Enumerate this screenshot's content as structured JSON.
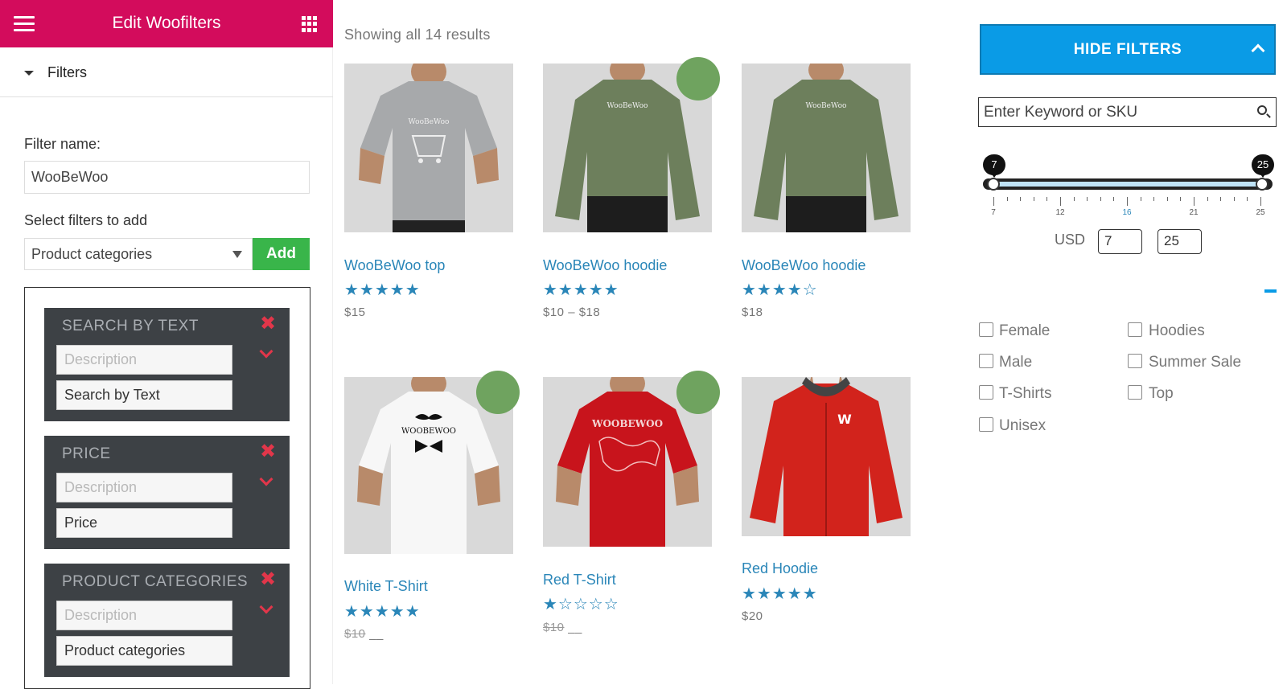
{
  "panel": {
    "title": "Edit Woofilters",
    "section": "Filters",
    "filter_name_label": "Filter name:",
    "filter_name_value": "WooBeWoo",
    "select_label": "Select filters to add",
    "select_value": "Product categories",
    "add_label": "Add",
    "close_glyph": "✖",
    "cards": [
      {
        "title": "SEARCH BY TEXT",
        "description_placeholder": "Description",
        "name": "Search by Text"
      },
      {
        "title": "PRICE",
        "description_placeholder": "Description",
        "name": "Price"
      },
      {
        "title": "PRODUCT CATEGORIES",
        "description_placeholder": "Description",
        "name": "Product categories"
      }
    ]
  },
  "shop": {
    "results": "Showing all 14 results",
    "products": [
      {
        "name": "WooBeWoo top",
        "rating": 5,
        "stars": "★★★★★",
        "price": "$15",
        "color": "#a3a5a8",
        "on_sale": false
      },
      {
        "name": "WooBeWoo hoodie",
        "rating": 5,
        "stars": "★★★★★",
        "price": "$10 – $18",
        "color": "#6d7f5c",
        "on_sale": true
      },
      {
        "name": "WooBeWoo hoodie",
        "rating": 4,
        "stars": "★★★★☆",
        "price": "$18",
        "color": "#6d7f5c",
        "on_sale": false
      },
      {
        "name": "White T-Shirt",
        "rating": 5,
        "stars": "★★★★★",
        "price_old": "$10",
        "price_new": "__",
        "color": "#f4f4f4",
        "on_sale": true
      },
      {
        "name": "Red T-Shirt",
        "rating": 1,
        "stars": "★☆☆☆☆",
        "price_old": "$10",
        "price_new": "__",
        "color": "#c8141c",
        "on_sale": true
      },
      {
        "name": "Red Hoodie",
        "rating": 5,
        "stars": "★★★★★",
        "price": "$20",
        "color": "#d2231c",
        "on_sale": false
      }
    ]
  },
  "filters": {
    "hide_label": "HIDE FILTERS",
    "search_placeholder": "Enter Keyword or SKU",
    "price_min": "7",
    "price_max": "25",
    "tick_labels": [
      "7",
      "12",
      "16",
      "21",
      "25"
    ],
    "currency": "USD",
    "input_min": "7",
    "input_max": "25",
    "categories_left": [
      "Female",
      "Male",
      "T-Shirts",
      "Unisex"
    ],
    "categories_right": [
      "Hoodies",
      "Summer Sale",
      "Top"
    ]
  },
  "colors": {
    "header": "#d30c5c",
    "add_button": "#39b54a",
    "hide_button": "#0a9be6",
    "link": "#2a86b8",
    "sale_badge": "#6fa35f"
  },
  "icons": [
    "hamburger-icon",
    "apps-grid-icon",
    "caret-down-icon",
    "close-icon",
    "chevron-down-icon",
    "search-icon",
    "chevron-up-icon"
  ]
}
